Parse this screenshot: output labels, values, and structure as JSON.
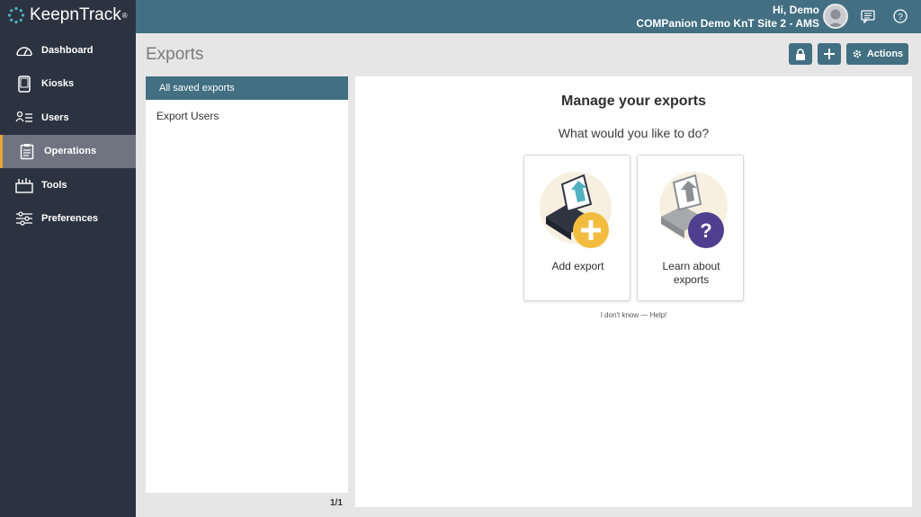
{
  "app": {
    "logo_text": "KeepnTrack",
    "logo_mark": "®"
  },
  "sidebar": {
    "items": [
      {
        "label": "Dashboard",
        "icon": "gauge-icon",
        "active": false
      },
      {
        "label": "Kiosks",
        "icon": "tablet-icon",
        "active": false
      },
      {
        "label": "Users",
        "icon": "users-list-icon",
        "active": false
      },
      {
        "label": "Operations",
        "icon": "clipboard-icon",
        "active": true
      },
      {
        "label": "Tools",
        "icon": "toolbox-icon",
        "active": false
      },
      {
        "label": "Preferences",
        "icon": "sliders-icon",
        "active": false
      }
    ]
  },
  "header": {
    "greeting": "Hi, Demo",
    "site": "COMPanion Demo KnT Site 2 - AMS"
  },
  "page": {
    "title": "Exports",
    "actions_label": "Actions"
  },
  "list": {
    "header": "All saved exports",
    "items": [
      "Export Users"
    ],
    "pager": "1/1"
  },
  "main": {
    "title": "Manage your exports",
    "question": "What would you like to do?",
    "cards": [
      {
        "label": "Add export"
      },
      {
        "label_line1": "Learn about",
        "label_line2": "exports"
      }
    ],
    "help": "I don't know — Help!"
  },
  "colors": {
    "sidebar": "#2c3340",
    "topbar": "#426f82",
    "accent": "#e8a33a",
    "add_badge": "#f2bd3f",
    "help_badge": "#4f3f8f"
  }
}
